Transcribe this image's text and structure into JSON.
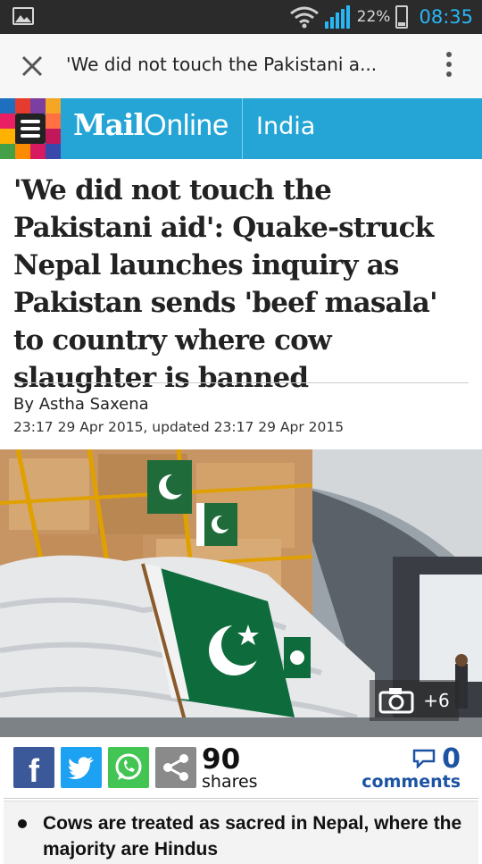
{
  "status_bar": {
    "battery_percent": "22%",
    "time": "08:35",
    "icons": [
      "image-icon",
      "wifi-icon",
      "signal-icon",
      "battery-icon"
    ]
  },
  "browser": {
    "tab_title": "'We did not touch the Pakistani a...",
    "icons": [
      "close-icon",
      "overflow-menu-icon"
    ]
  },
  "site": {
    "brand_bold": "Mail",
    "brand_light": "Online",
    "section": "India",
    "colors": {
      "brand": "#25a5d6",
      "link": "#1c53a3"
    }
  },
  "article": {
    "headline": "'We did not touch the Pakistani aid': Quake-struck Nepal launches inquiry as Pakistan sends 'beef masala' to country where cow slaughter is banned",
    "byline": "By Astha Saxena",
    "dates": "23:17 29 Apr 2015, updated 23:17 29 Apr 2015",
    "photo_badge": "+6",
    "bullets": [
      "Cows are treated as sacred in Nepal, where the majority are Hindus"
    ]
  },
  "share": {
    "buttons": [
      "facebook-icon",
      "twitter-icon",
      "whatsapp-icon",
      "share-icon"
    ],
    "count": "90",
    "count_label": "shares",
    "comments_count": "0",
    "comments_label": "comments"
  }
}
